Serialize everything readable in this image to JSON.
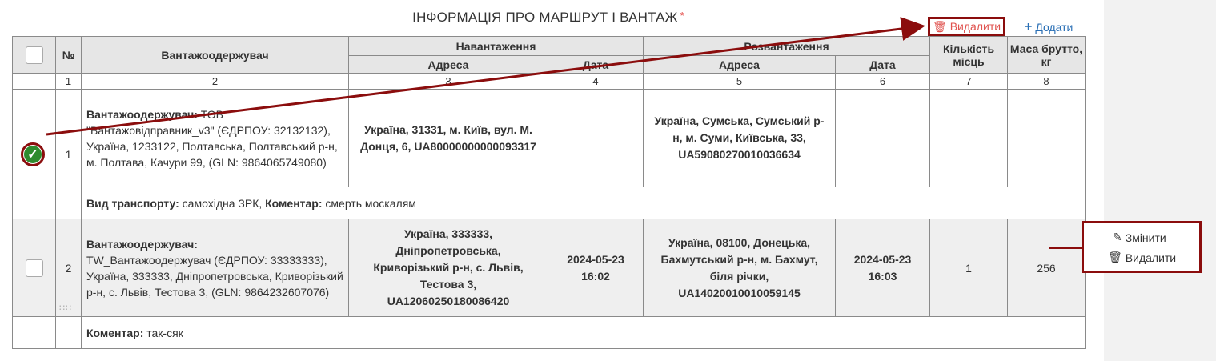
{
  "section_title": "ІНФОРМАЦІЯ ПРО МАРШРУТ І ВАНТАЖ",
  "required_mark": "*",
  "toolbar": {
    "delete_label": "Видалити",
    "add_label": "Додати"
  },
  "table": {
    "headers": {
      "number": "№",
      "consignee": "Вантажоодержувач",
      "loading": "Навантаження",
      "unloading": "Розвантаження",
      "address": "Адреса",
      "date": "Дата",
      "places": "Кількість місць",
      "gross_weight": "Маса брутто, кг"
    },
    "column_numbers": [
      "1",
      "2",
      "3",
      "4",
      "5",
      "6",
      "7",
      "8"
    ],
    "rows": [
      {
        "checked": true,
        "number": "1",
        "consignee_label": "Вантажоодержувач:",
        "consignee_text": " ТОВ \"Вантажовідправник_v3\" (ЄДРПОУ: 32132132), Україна, 1233122, Полтавська, Полтавський р-н, м. Полтава, Качури 99, (GLN: 9864065749080)",
        "load_address": "Україна, 31331, м. Київ, вул. М. Донця, 6, UA80000000000093317",
        "load_date": "",
        "unload_address": "Україна, Сумська, Сумський р-н, м. Суми, Київська, 33, UA59080270010036634",
        "unload_date": "",
        "places": "",
        "weight": "",
        "info_transport_label": "Вид транспорту:",
        "info_transport_text": " самохідна ЗРК, ",
        "info_comment_label": "Коментар:",
        "info_comment_text": " смерть москалям"
      },
      {
        "checked": false,
        "number": "2",
        "consignee_label": "Вантажоодержувач:",
        "consignee_text": "TW_Вантажоодержувач (ЄДРПОУ: 33333333), Україна, 333333, Дніпропетровська, Криворізький р-н, с. Львів, Тестова 3, (GLN: 9864232607076)",
        "load_address": "Україна, 333333, Дніпропетровська, Криворізький р-н, с. Львів, Тестова 3, UA12060250180086420",
        "load_date": "2024-05-23 16:02",
        "unload_address": "Україна, 08100, Донецька, Бахмутський р-н, м. Бахмут, біля річки, UA14020010010059145",
        "unload_date": "2024-05-23 16:03",
        "places": "1",
        "weight": "256",
        "info_comment_label": "Коментар:",
        "info_comment_text": " так-сяк"
      }
    ]
  },
  "row_actions": {
    "edit_label": "Змінити",
    "delete_label": "Видалити"
  },
  "colors": {
    "highlight": "#8b0d0d",
    "danger": "#e0534f",
    "link": "#2a6fb5",
    "check": "#2e8b2e"
  }
}
